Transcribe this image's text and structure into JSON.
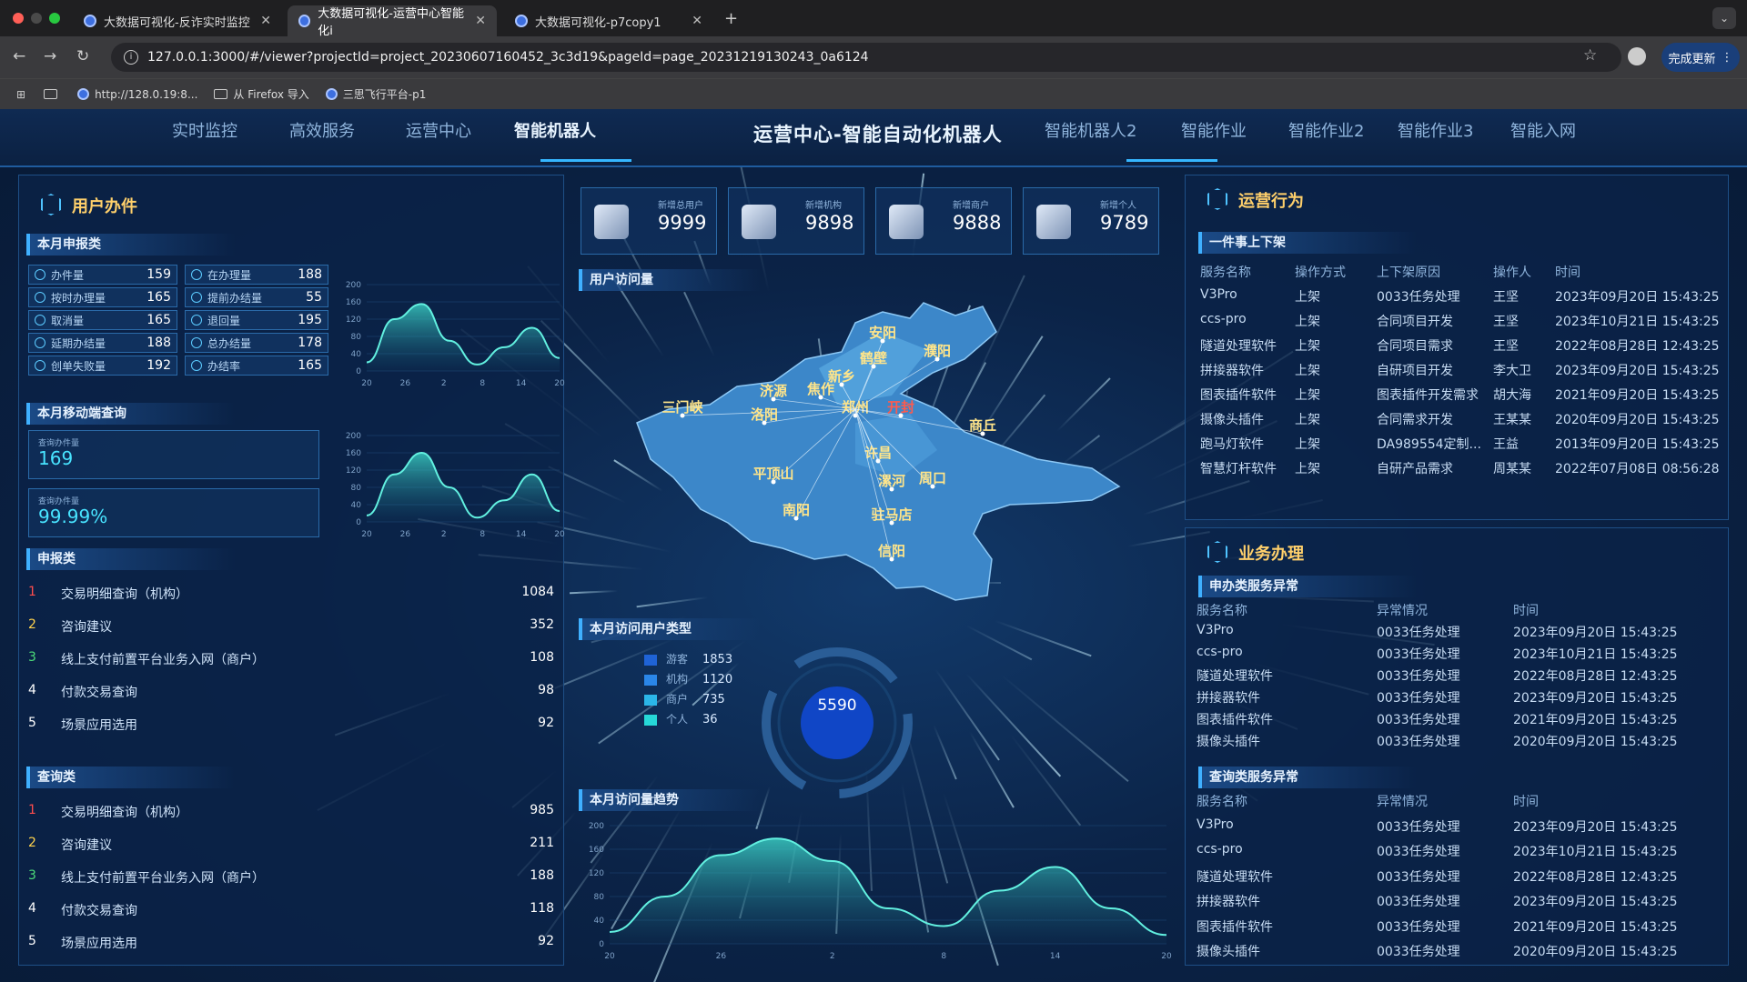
{
  "browser": {
    "tabs": [
      {
        "title": "大数据可视化-反诈实时监控"
      },
      {
        "title": "大数据可视化-运营中心智能化i"
      },
      {
        "title": "大数据可视化-p7copy1"
      }
    ],
    "url": "127.0.0.1:3000/#/viewer?projectId=project_20230607160452_3c3d19&pageId=page_20231219130243_0a6124",
    "update_label": "完成更新",
    "bookmarks": [
      "http://128.0.19:8...",
      "从 Firefox 导入",
      "三思飞行平台-p1"
    ]
  },
  "nav": {
    "items": [
      "实时监控",
      "高效服务",
      "运营中心",
      "智能机器人",
      "智能机器人2",
      "智能作业",
      "智能作业2",
      "智能作业3",
      "智能入网"
    ],
    "active": "智能机器人",
    "title": "运营中心-智能自动化机器人"
  },
  "left": {
    "title": "用户办件",
    "month_title": "本月申报类",
    "stats": [
      {
        "label": "办件量",
        "value": "159"
      },
      {
        "label": "在办理量",
        "value": "188"
      },
      {
        "label": "按时办理量",
        "value": "165"
      },
      {
        "label": "提前办结量",
        "value": "55"
      },
      {
        "label": "取消量",
        "value": "165"
      },
      {
        "label": "退回量",
        "value": "195"
      },
      {
        "label": "延期办结量",
        "value": "188"
      },
      {
        "label": "总办结量",
        "value": "178"
      },
      {
        "label": "创单失败量",
        "value": "192"
      },
      {
        "label": "办结率",
        "value": "165"
      }
    ],
    "mobile_title": "本月移动端查询",
    "query_label": "查询办件量",
    "query1": "169",
    "query2": "99.99%",
    "apply_title": "申报类",
    "apply": [
      {
        "no": "1",
        "name": "交易明细查询（机构）",
        "count": "1084"
      },
      {
        "no": "2",
        "name": "咨询建议",
        "count": "352"
      },
      {
        "no": "3",
        "name": "线上支付前置平台业务入网（商户）",
        "count": "108"
      },
      {
        "no": "4",
        "name": "付款交易查询",
        "count": "98"
      },
      {
        "no": "5",
        "name": "场景应用选用",
        "count": "92"
      }
    ],
    "query_title": "查询类",
    "query": [
      {
        "no": "1",
        "name": "交易明细查询（机构）",
        "count": "985"
      },
      {
        "no": "2",
        "name": "咨询建议",
        "count": "211"
      },
      {
        "no": "3",
        "name": "线上支付前置平台业务入网（商户）",
        "count": "188"
      },
      {
        "no": "4",
        "name": "付款交易查询",
        "count": "118"
      },
      {
        "no": "5",
        "name": "场景应用选用",
        "count": "92"
      }
    ]
  },
  "kpis": [
    {
      "label": "新增总用户",
      "value": "9999"
    },
    {
      "label": "新增机构",
      "value": "9898"
    },
    {
      "label": "新增商户",
      "value": "9888"
    },
    {
      "label": "新增个人",
      "value": "9789"
    }
  ],
  "map": {
    "title": "用户访问量",
    "cities": [
      "安阳",
      "鹤壁",
      "濮阳",
      "新乡",
      "济源",
      "焦作",
      "三门峡",
      "郑州",
      "开封",
      "洛阳",
      "商丘",
      "许昌",
      "平顶山",
      "漯河",
      "周口",
      "南阳",
      "驻马店",
      "信阳"
    ]
  },
  "user_type": {
    "title": "本月访问用户类型",
    "total": "5590",
    "items": [
      {
        "name": "游客",
        "value": "1853",
        "color": "#1f63d6"
      },
      {
        "name": "机构",
        "value": "1120",
        "color": "#2a86e8"
      },
      {
        "name": "商户",
        "value": "735",
        "color": "#2bb6e8"
      },
      {
        "name": "个人",
        "value": "36",
        "color": "#26d8d8"
      }
    ]
  },
  "trend_title": "本月访问量趋势",
  "right": {
    "ops_title": "运营行为",
    "shelf_title": "一件事上下架",
    "shelf_headers": [
      "服务名称",
      "操作方式",
      "上下架原因",
      "操作人",
      "时间"
    ],
    "shelf_rows": [
      [
        "V3Pro",
        "上架",
        "0033任务处理",
        "王坚",
        "2023年09月20日 15:43:25"
      ],
      [
        "ccs-pro",
        "上架",
        "合同项目开发",
        "王坚",
        "2023年10月21日 15:43:25"
      ],
      [
        "隧道处理软件",
        "上架",
        "合同项目需求",
        "王坚",
        "2022年08月28日 12:43:25"
      ],
      [
        "拼接器软件",
        "上架",
        "自研项目开发",
        "李大卫",
        "2023年09月20日 15:43:25"
      ],
      [
        "图表插件软件",
        "上架",
        "图表插件开发需求",
        "胡大海",
        "2021年09月20日 15:43:25"
      ],
      [
        "摄像头插件",
        "上架",
        "合同需求开发",
        "王某某",
        "2020年09月20日 15:43:25"
      ],
      [
        "跑马灯软件",
        "上架",
        "DA989554定制...",
        "王益",
        "2013年09月20日 15:43:25"
      ],
      [
        "智慧灯杆软件",
        "上架",
        "自研产品需求",
        "周某某",
        "2022年07月08日 08:56:28"
      ]
    ],
    "biz_title": "业务办理",
    "apply_err_title": "申办类服务异常",
    "err_headers": [
      "服务名称",
      "异常情况",
      "时间"
    ],
    "apply_err_rows": [
      [
        "V3Pro",
        "0033任务处理",
        "2023年09月20日 15:43:25"
      ],
      [
        "ccs-pro",
        "0033任务处理",
        "2023年10月21日 15:43:25"
      ],
      [
        "隧道处理软件",
        "0033任务处理",
        "2022年08月28日 12:43:25"
      ],
      [
        "拼接器软件",
        "0033任务处理",
        "2023年09月20日 15:43:25"
      ],
      [
        "图表插件软件",
        "0033任务处理",
        "2021年09月20日 15:43:25"
      ],
      [
        "摄像头插件",
        "0033任务处理",
        "2020年09月20日 15:43:25"
      ]
    ],
    "query_err_title": "查询类服务异常",
    "query_err_rows": [
      [
        "V3Pro",
        "0033任务处理",
        "2023年09月20日 15:43:25"
      ],
      [
        "ccs-pro",
        "0033任务处理",
        "2023年10月21日 15:43:25"
      ],
      [
        "隧道处理软件",
        "0033任务处理",
        "2022年08月28日 12:43:25"
      ],
      [
        "拼接器软件",
        "0033任务处理",
        "2023年09月20日 15:43:25"
      ],
      [
        "图表插件软件",
        "0033任务处理",
        "2021年09月20日 15:43:25"
      ],
      [
        "摄像头插件",
        "0033任务处理",
        "2020年09月20日 15:43:25"
      ]
    ]
  },
  "chart_data": [
    {
      "type": "area",
      "x": [
        20,
        26,
        2,
        8,
        14,
        20
      ],
      "y_ticks": [
        0,
        40,
        80,
        120,
        160,
        200
      ],
      "series": [
        {
          "values": [
            20,
            120,
            155,
            70,
            15,
            55,
            100,
            30
          ]
        }
      ],
      "ylim": [
        0,
        200
      ]
    },
    {
      "type": "area",
      "x": [
        20,
        26,
        2,
        8,
        14,
        20
      ],
      "y_ticks": [
        0,
        40,
        80,
        120,
        160,
        200
      ],
      "series": [
        {
          "values": [
            15,
            110,
            160,
            80,
            10,
            50,
            110,
            25
          ]
        }
      ],
      "ylim": [
        0,
        200
      ]
    },
    {
      "type": "area",
      "x": [
        20,
        26,
        2,
        8,
        14,
        20
      ],
      "y_ticks": [
        0,
        40,
        80,
        120,
        160,
        200
      ],
      "series": [
        {
          "values": [
            20,
            80,
            150,
            178,
            140,
            60,
            30,
            90,
            130,
            60,
            15
          ]
        }
      ],
      "ylim": [
        0,
        200
      ]
    }
  ]
}
